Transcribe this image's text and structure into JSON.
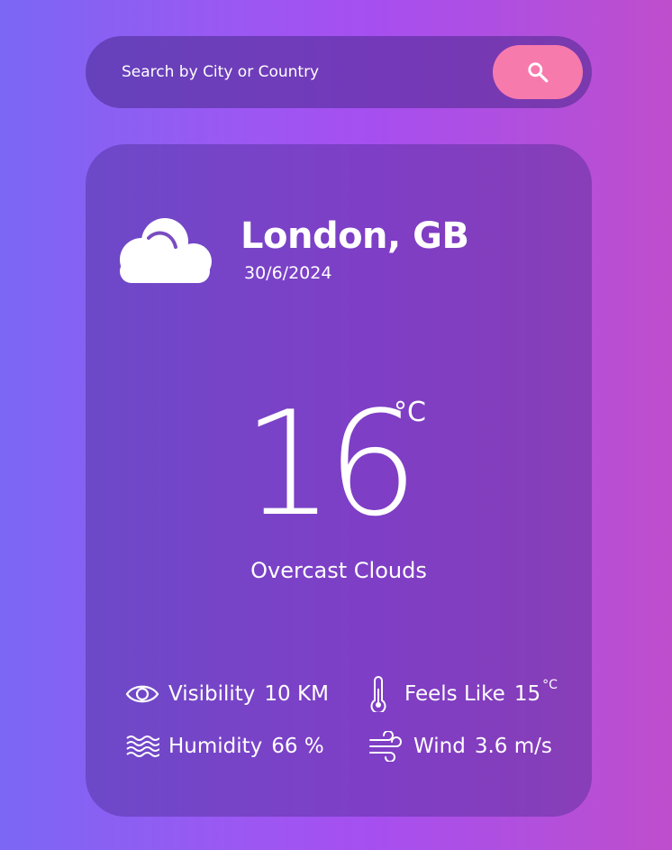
{
  "search": {
    "placeholder": "Search by City or Country",
    "button_icon": "search-icon"
  },
  "weather": {
    "icon": "cloud-icon",
    "city": "London, GB",
    "date": "30/6/2024",
    "temperature": "16",
    "temperature_unit": "°C",
    "description": "Overcast Clouds"
  },
  "stats": {
    "visibility": {
      "icon": "eye-icon",
      "label": "Visibility",
      "value": "10 KM"
    },
    "feels_like": {
      "icon": "thermometer-icon",
      "label": "Feels Like",
      "value": "15",
      "unit": "°C"
    },
    "humidity": {
      "icon": "waves-icon",
      "label": "Humidity",
      "value": "66 %"
    },
    "wind": {
      "icon": "wind-icon",
      "label": "Wind",
      "value": "3.6 m/s"
    }
  },
  "colors": {
    "background_start": "#7b67f4",
    "background_end": "#bf4ecc",
    "search_button": "#f77aad",
    "text": "#ffffff"
  }
}
